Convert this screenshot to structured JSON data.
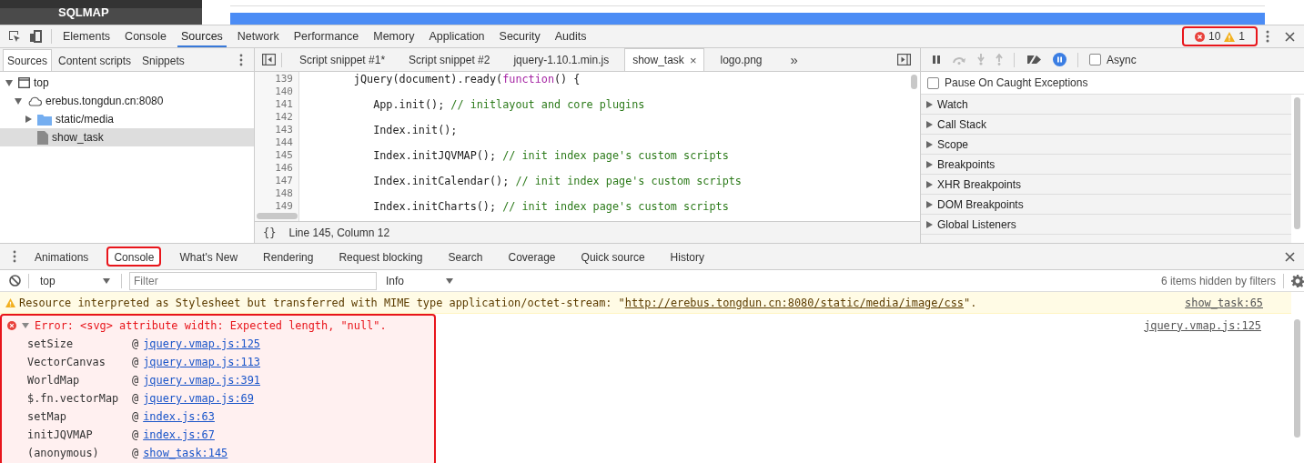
{
  "page": {
    "brand": "SQLMAP"
  },
  "toolbar": {
    "tabs": [
      {
        "label": "Elements",
        "selected": false
      },
      {
        "label": "Console",
        "selected": false
      },
      {
        "label": "Sources",
        "selected": true
      },
      {
        "label": "Network",
        "selected": false
      },
      {
        "label": "Performance",
        "selected": false
      },
      {
        "label": "Memory",
        "selected": false
      },
      {
        "label": "Application",
        "selected": false
      },
      {
        "label": "Security",
        "selected": false
      },
      {
        "label": "Audits",
        "selected": false
      }
    ],
    "errors": "10",
    "warnings": "1",
    "counts_highlighted": true
  },
  "navigator": {
    "tabs": [
      {
        "label": "Sources",
        "selected": true
      },
      {
        "label": "Content scripts",
        "selected": false
      },
      {
        "label": "Snippets",
        "selected": false
      }
    ],
    "tree": [
      {
        "label": "top",
        "kind": "frame",
        "expanded": true,
        "selected": false,
        "children": [
          {
            "label": "erebus.tongdun.cn:8080",
            "kind": "domain",
            "expanded": true,
            "selected": false,
            "children": [
              {
                "label": "static/media",
                "kind": "folder",
                "expanded": false,
                "selected": false
              },
              {
                "label": "show_task",
                "kind": "file",
                "selected": true
              }
            ]
          }
        ]
      }
    ]
  },
  "editor": {
    "tabs": [
      {
        "label": "Script snippet #1*",
        "selected": false
      },
      {
        "label": "Script snippet #2",
        "selected": false
      },
      {
        "label": "jquery-1.10.1.min.js",
        "selected": false
      },
      {
        "label": "show_task",
        "selected": true,
        "close": "×"
      },
      {
        "label": "logo.png",
        "selected": false
      }
    ],
    "more": "»",
    "lines": [
      {
        "number": "139",
        "segments": [
          {
            "kind": "plain",
            "text": "        jQuery(document).ready("
          },
          {
            "kind": "keyword",
            "text": "function"
          },
          {
            "kind": "plain",
            "text": "() {"
          }
        ]
      },
      {
        "number": "140"
      },
      {
        "number": "141",
        "segments": [
          {
            "kind": "plain",
            "text": "           App.init(); "
          },
          {
            "kind": "comment",
            "text": "// initlayout and core plugins"
          }
        ]
      },
      {
        "number": "142"
      },
      {
        "number": "143",
        "segments": [
          {
            "kind": "plain",
            "text": "           Index.init();"
          }
        ]
      },
      {
        "number": "144"
      },
      {
        "number": "145",
        "segments": [
          {
            "kind": "plain",
            "text": "           Index.initJQVMAP(); "
          },
          {
            "kind": "comment",
            "text": "// init index page's custom scripts"
          }
        ]
      },
      {
        "number": "146"
      },
      {
        "number": "147",
        "segments": [
          {
            "kind": "plain",
            "text": "           Index.initCalendar(); "
          },
          {
            "kind": "comment",
            "text": "// init index page's custom scripts"
          }
        ]
      },
      {
        "number": "148"
      },
      {
        "number": "149",
        "segments": [
          {
            "kind": "plain",
            "text": "           Index.initCharts(); "
          },
          {
            "kind": "comment",
            "text": "// init index page's custom scripts"
          }
        ]
      }
    ],
    "format": "{}",
    "status": "Line 145, Column 12"
  },
  "debugger": {
    "async": {
      "label": "Async",
      "checked": false
    },
    "pause_caught": {
      "label": "Pause On Caught Exceptions",
      "checked": false
    },
    "sections": [
      {
        "label": "Watch",
        "expanded": false
      },
      {
        "label": "Call Stack",
        "expanded": false
      },
      {
        "label": "Scope",
        "expanded": false
      },
      {
        "label": "Breakpoints",
        "expanded": false
      },
      {
        "label": "XHR Breakpoints",
        "expanded": false
      },
      {
        "label": "DOM Breakpoints",
        "expanded": false
      },
      {
        "label": "Global Listeners",
        "expanded": false
      }
    ]
  },
  "drawer": {
    "tabs": [
      {
        "label": "Animations",
        "selected": false,
        "highlighted": false
      },
      {
        "label": "Console",
        "selected": true,
        "highlighted": true
      },
      {
        "label": "What's New",
        "selected": false,
        "highlighted": false
      },
      {
        "label": "Rendering",
        "selected": false,
        "highlighted": false
      },
      {
        "label": "Request blocking",
        "selected": false,
        "highlighted": false
      },
      {
        "label": "Search",
        "selected": false,
        "highlighted": false
      },
      {
        "label": "Coverage",
        "selected": false,
        "highlighted": false
      },
      {
        "label": "Quick source",
        "selected": false,
        "highlighted": false
      },
      {
        "label": "History",
        "selected": false,
        "highlighted": false
      }
    ],
    "context": "top",
    "filter_placeholder": "Filter",
    "level": "Info",
    "hidden": "6 items hidden by filters"
  },
  "messages": [
    {
      "kind": "warning",
      "text": "Resource interpreted as Stylesheet but transferred with MIME type application/octet-stream: \"",
      "link": "http://erebus.tongdun.cn:8080/static/media/image/css",
      "after": "\".",
      "source": "show_task:65",
      "highlighted": false
    },
    {
      "kind": "error",
      "text": "Error: <svg> attribute width: Expected length, \"null\".",
      "source": "jquery.vmap.js:125",
      "expanded": true,
      "highlighted": true,
      "stack": [
        {
          "fn": "setSize",
          "at": "@",
          "link": "jquery.vmap.js:125"
        },
        {
          "fn": "VectorCanvas",
          "at": "@",
          "link": "jquery.vmap.js:113"
        },
        {
          "fn": "WorldMap",
          "at": "@",
          "link": "jquery.vmap.js:391"
        },
        {
          "fn": "$.fn.vectorMap",
          "at": "@",
          "link": "jquery.vmap.js:69"
        },
        {
          "fn": "setMap",
          "at": "@",
          "link": "index.js:63"
        },
        {
          "fn": "initJQVMAP",
          "at": "@",
          "link": "index.js:67"
        },
        {
          "fn": "(anonymous)",
          "at": "@",
          "link": "show_task:145"
        }
      ]
    }
  ]
}
